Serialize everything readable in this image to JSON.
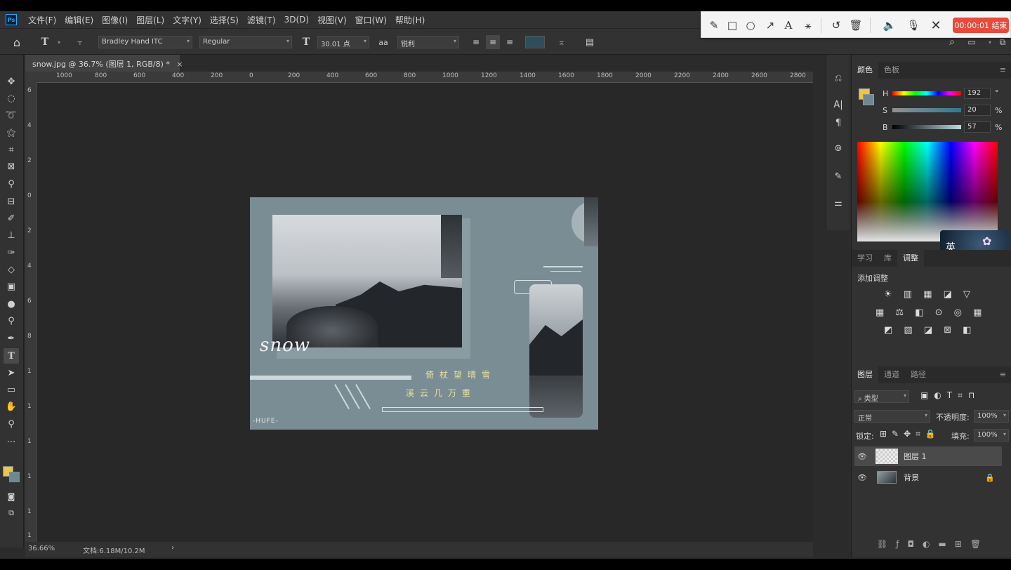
{
  "app": {
    "logo": "Ps"
  },
  "menu": [
    "文件(F)",
    "编辑(E)",
    "图像(I)",
    "图层(L)",
    "文字(Y)",
    "选择(S)",
    "滤镜(T)",
    "3D(D)",
    "视图(V)",
    "窗口(W)",
    "帮助(H)"
  ],
  "options": {
    "font_family": "Bradley Hand ITC",
    "font_style": "Regular",
    "font_size": "30.01 点",
    "anti_alias_label": "aa",
    "anti_alias": "锐利",
    "text_color": "#2e4f5a"
  },
  "recorder": {
    "timer": "00:00:01 结束"
  },
  "document": {
    "tab_title": "snow.jpg @ 36.7% (图层 1, RGB/8) *",
    "close": "×",
    "ruler_h": [
      "1000",
      "800",
      "600",
      "400",
      "200",
      "0",
      "200",
      "400",
      "600",
      "800",
      "1000",
      "1200",
      "1400",
      "1600",
      "1800",
      "2000",
      "2200",
      "2400",
      "2600",
      "2800"
    ],
    "ruler_v": [
      "6",
      "4",
      "2",
      "0",
      "2",
      "4",
      "6",
      "8",
      "1",
      "1",
      "1",
      "1",
      "1",
      "1"
    ],
    "zoom": "36.66%",
    "doc_info": "文档:6.18M/10.2M",
    "arrow": "›"
  },
  "artwork": {
    "title_text": "snow",
    "poem_line1": "倚杖望晴雪",
    "poem_line2": "溪云几万重",
    "signature": "-HUFE-",
    "bg_color": "#7b8d94",
    "poem_color": "#e6e09c"
  },
  "color_panel": {
    "tabs": [
      "颜色",
      "色板"
    ],
    "h_label": "H",
    "h_value": "192",
    "h_unit": "°",
    "s_label": "S",
    "s_value": "20",
    "s_unit": "%",
    "b_label": "B",
    "b_value": "57",
    "b_unit": "%",
    "foreground": "#e8c84a"
  },
  "adjust_panel": {
    "tabs": [
      "学习",
      "库",
      "调整"
    ],
    "title": "添加调整",
    "ime_badge": "英"
  },
  "layers_panel": {
    "tabs": [
      "图层",
      "通道",
      "路径"
    ],
    "filter": "类型",
    "blend_mode": "正常",
    "opacity_label": "不透明度:",
    "opacity_value": "100%",
    "lock_label": "锁定:",
    "fill_label": "填充:",
    "fill_value": "100%",
    "layers": [
      {
        "name": "图层 1",
        "selected": true
      },
      {
        "name": "背景",
        "selected": false
      }
    ]
  }
}
